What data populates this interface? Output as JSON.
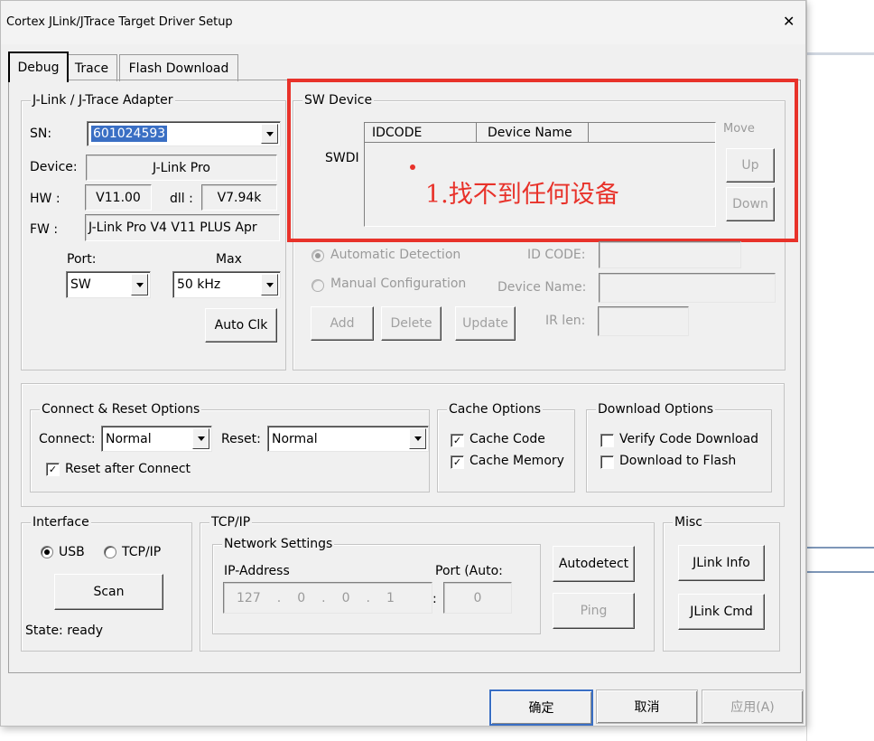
{
  "window": {
    "title": "Cortex JLink/JTrace Target Driver Setup",
    "close_glyph": "✕"
  },
  "tabs": [
    {
      "label": "Debug"
    },
    {
      "label": "Trace"
    },
    {
      "label": "Flash Download"
    }
  ],
  "adapter": {
    "legend": "J-Link / J-Trace Adapter",
    "sn_label": "SN:",
    "sn_value": "601024593",
    "device_label": "Device:",
    "device_value": "J-Link Pro",
    "hw_label": "HW :",
    "hw_value": "V11.00",
    "dll_label": "dll :",
    "dll_value": "V7.94k",
    "fw_label": "FW :",
    "fw_value": "J-Link Pro V4 V11 PLUS Apr",
    "port_label": "Port:",
    "port_value": "SW",
    "max_label": "Max",
    "max_value": "50 kHz",
    "auto_clk": "Auto Clk"
  },
  "sw_device": {
    "legend": "SW Device",
    "swdi_label": "SWDI",
    "columns": [
      "IDCODE",
      "Device Name"
    ],
    "move_label": "Move",
    "up": "Up",
    "down": "Down",
    "annotation": "1.找不到任何设备",
    "auto_detect": "Automatic Detection",
    "manual_config": "Manual Configuration",
    "id_code_label": "ID CODE:",
    "device_name_label": "Device Name:",
    "ir_len_label": "IR len:",
    "add": "Add",
    "delete": "Delete",
    "update": "Update"
  },
  "connect_reset": {
    "legend": "Connect & Reset Options",
    "connect_label": "Connect:",
    "connect_value": "Normal",
    "reset_label": "Reset:",
    "reset_value": "Normal",
    "reset_after_connect": "Reset after Connect"
  },
  "cache": {
    "legend": "Cache Options",
    "cache_code": "Cache Code",
    "cache_memory": "Cache Memory"
  },
  "download": {
    "legend": "Download Options",
    "verify": "Verify Code Download",
    "to_flash": "Download to Flash"
  },
  "interface": {
    "legend": "Interface",
    "usb": "USB",
    "tcpip": "TCP/IP",
    "scan": "Scan",
    "state": "State: ready"
  },
  "tcpip": {
    "legend": "TCP/IP",
    "network_legend": "Network Settings",
    "ip_label": "IP-Address",
    "port_label": "Port (Auto:",
    "ip_octets": [
      "127",
      "0",
      "0",
      "1"
    ],
    "port_value": "0",
    "port_sep": ":",
    "autodetect": "Autodetect",
    "ping": "Ping"
  },
  "misc": {
    "legend": "Misc",
    "jlink_info": "JLink Info",
    "jlink_cmd": "JLink Cmd"
  },
  "footer": {
    "ok": "确定",
    "cancel": "取消",
    "apply": "应用(A)"
  },
  "colors": {
    "annotation_red": "#e8322a",
    "selection_blue": "#3a6fc4"
  }
}
